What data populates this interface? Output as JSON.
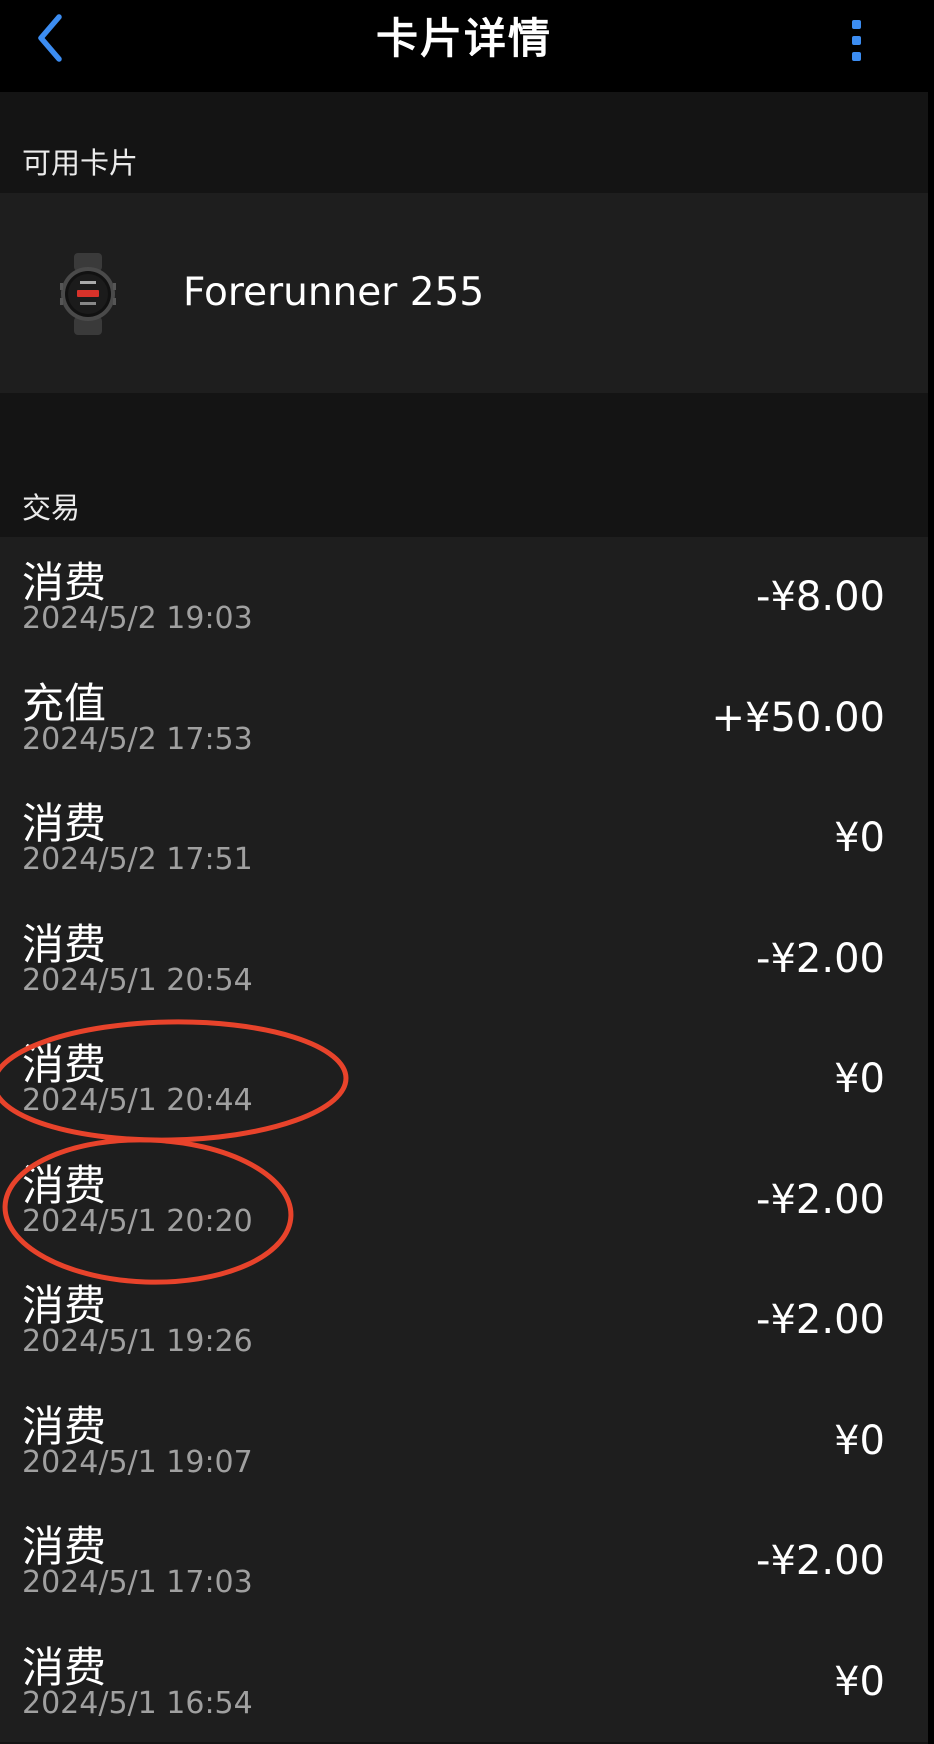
{
  "header": {
    "title": "卡片详情",
    "back_icon": "chevron-left-icon",
    "more_icon": "more-vertical-icon",
    "accent_color": "#3c8df2"
  },
  "cards_section": {
    "label": "可用卡片",
    "card": {
      "name": "Forerunner 255",
      "icon": "smartwatch-icon"
    }
  },
  "transactions_section": {
    "label": "交易",
    "items": [
      {
        "type": "消费",
        "time": "2024/5/2 19:03",
        "amount": "-¥8.00"
      },
      {
        "type": "充值",
        "time": "2024/5/2 17:53",
        "amount": "+¥50.00"
      },
      {
        "type": "消费",
        "time": "2024/5/2 17:51",
        "amount": "¥0"
      },
      {
        "type": "消费",
        "time": "2024/5/1 20:54",
        "amount": "-¥2.00"
      },
      {
        "type": "消费",
        "time": "2024/5/1 20:44",
        "amount": "¥0"
      },
      {
        "type": "消费",
        "time": "2024/5/1 20:20",
        "amount": "-¥2.00"
      },
      {
        "type": "消费",
        "time": "2024/5/1 19:26",
        "amount": "-¥2.00"
      },
      {
        "type": "消费",
        "time": "2024/5/1 19:07",
        "amount": "¥0"
      },
      {
        "type": "消费",
        "time": "2024/5/1 17:03",
        "amount": "-¥2.00"
      },
      {
        "type": "消费",
        "time": "2024/5/1 16:54",
        "amount": "¥0"
      }
    ]
  },
  "annotation": {
    "color": "#e8432b",
    "circled_transaction_times": [
      "2024/5/1 20:44",
      "2024/5/1 20:20"
    ]
  }
}
